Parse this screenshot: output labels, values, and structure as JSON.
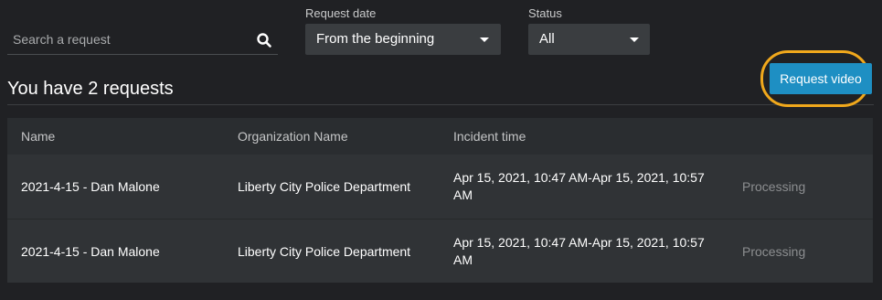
{
  "search": {
    "placeholder": "Search a request",
    "value": ""
  },
  "filters": {
    "request_date": {
      "label": "Request date",
      "selected": "From the beginning"
    },
    "status": {
      "label": "Status",
      "selected": "All"
    }
  },
  "heading": "You have 2 requests",
  "request_video_label": "Request video",
  "colors": {
    "accent": "#1e8fc3",
    "highlight": "#f0a81c",
    "background": "#202124"
  },
  "table": {
    "columns": [
      "Name",
      "Organization Name",
      "Incident time"
    ],
    "rows": [
      {
        "name": "2021-4-15 - Dan Malone",
        "organization": "Liberty City Police Department",
        "incident_time": "Apr 15, 2021, 10:47 AM-Apr 15, 2021, 10:57 AM",
        "status": "Processing"
      },
      {
        "name": "2021-4-15 - Dan Malone",
        "organization": "Liberty City Police Department",
        "incident_time": "Apr 15, 2021, 10:47 AM-Apr 15, 2021, 10:57 AM",
        "status": "Processing"
      }
    ]
  }
}
